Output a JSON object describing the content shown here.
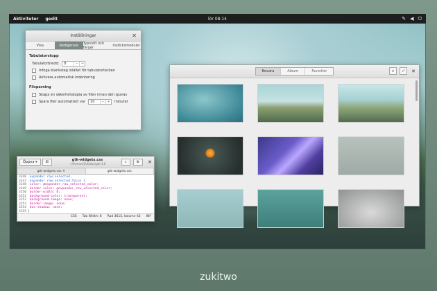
{
  "topbar": {
    "activities": "Aktiviteter",
    "app": "gedit",
    "clock": "lör 08:14"
  },
  "prefs": {
    "title": "Inställningar",
    "tabs": [
      "Visa",
      "Redigerare",
      "Typsnitt och färger",
      "Insticksmoduler"
    ],
    "section_tabs": "Tabulatorstopp",
    "tab_width_label": "Tabulatorbredd:",
    "tab_width_value": "8",
    "insert_spaces": "Infoga blanksteg istället för tabulatortecken",
    "auto_indent": "Aktivera automatisk indentering",
    "section_save": "Filsparning",
    "backup": "Skapa en säkerhetskopia av filen innan den sparas",
    "autosave": "Spara filer automatiskt var",
    "autosave_value": "10",
    "autosave_unit": "minuter"
  },
  "gedit": {
    "open_label": "Öppna",
    "title": "gtk-widgets.css",
    "subtitle": "~/themes/Zukitwo/gtk-3.0",
    "tabs": [
      "gtk-widgets.css",
      "gtk-widgets.css"
    ],
    "lines": [
      {
        "n": "3346",
        "t": ".expander row:selected,"
      },
      {
        "n": "3347",
        "t": ".expander row:selected:focus {"
      },
      {
        "n": "3348",
        "t": "    color: @expander_row_selected_color;"
      },
      {
        "n": "3349",
        "t": "    border-color: @expander_row_selected_color;"
      },
      {
        "n": "3350",
        "t": "    border-width: 0;"
      },
      {
        "n": "3351",
        "t": "    background-color: transparent;"
      },
      {
        "n": "3352",
        "t": "    background-image: none;"
      },
      {
        "n": "3353",
        "t": "    border-image: none;"
      },
      {
        "n": "3354",
        "t": "    box-shadow: none;"
      },
      {
        "n": "3355",
        "t": "}"
      }
    ],
    "status": {
      "lang": "CSS",
      "tabwidth": "Tab Width: 8",
      "pos": "Rad 3615, kolumn 42",
      "mode": "INF"
    }
  },
  "backgrounds": {
    "segments": [
      "Bevara",
      "Album",
      "Favoriter"
    ],
    "active_segment": 0
  },
  "caption": "zukitwo"
}
